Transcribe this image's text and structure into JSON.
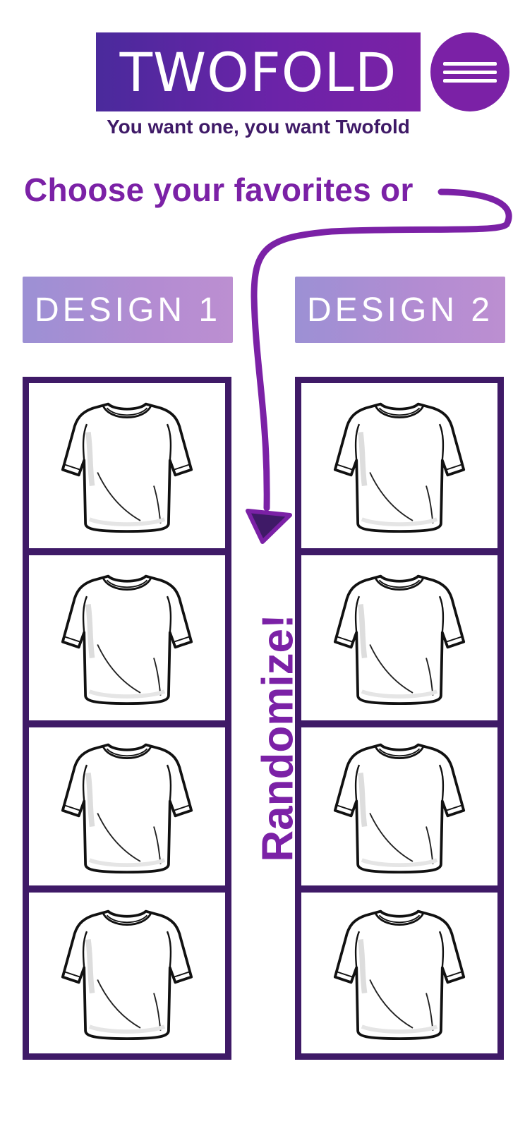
{
  "header": {
    "logo_text": "TWOFOLD",
    "tagline": "You want one, you want Twofold",
    "menu_icon": "hamburger-menu-icon"
  },
  "main": {
    "headline": "Choose your favorites or",
    "randomize_label": "Randomize!",
    "design_buttons": [
      {
        "label": "DESIGN 1"
      },
      {
        "label": "DESIGN 2"
      }
    ],
    "columns": [
      {
        "items": [
          {
            "icon": "tshirt-icon"
          },
          {
            "icon": "tshirt-icon"
          },
          {
            "icon": "tshirt-icon"
          },
          {
            "icon": "tshirt-icon"
          }
        ]
      },
      {
        "items": [
          {
            "icon": "tshirt-icon"
          },
          {
            "icon": "tshirt-icon"
          },
          {
            "icon": "tshirt-icon"
          },
          {
            "icon": "tshirt-icon"
          }
        ]
      }
    ]
  },
  "colors": {
    "brand_purple": "#7b21a6",
    "dark_purple": "#3f1a67",
    "deep_blue_purple": "#4a2a9c",
    "lavender": "#b38cd2"
  }
}
